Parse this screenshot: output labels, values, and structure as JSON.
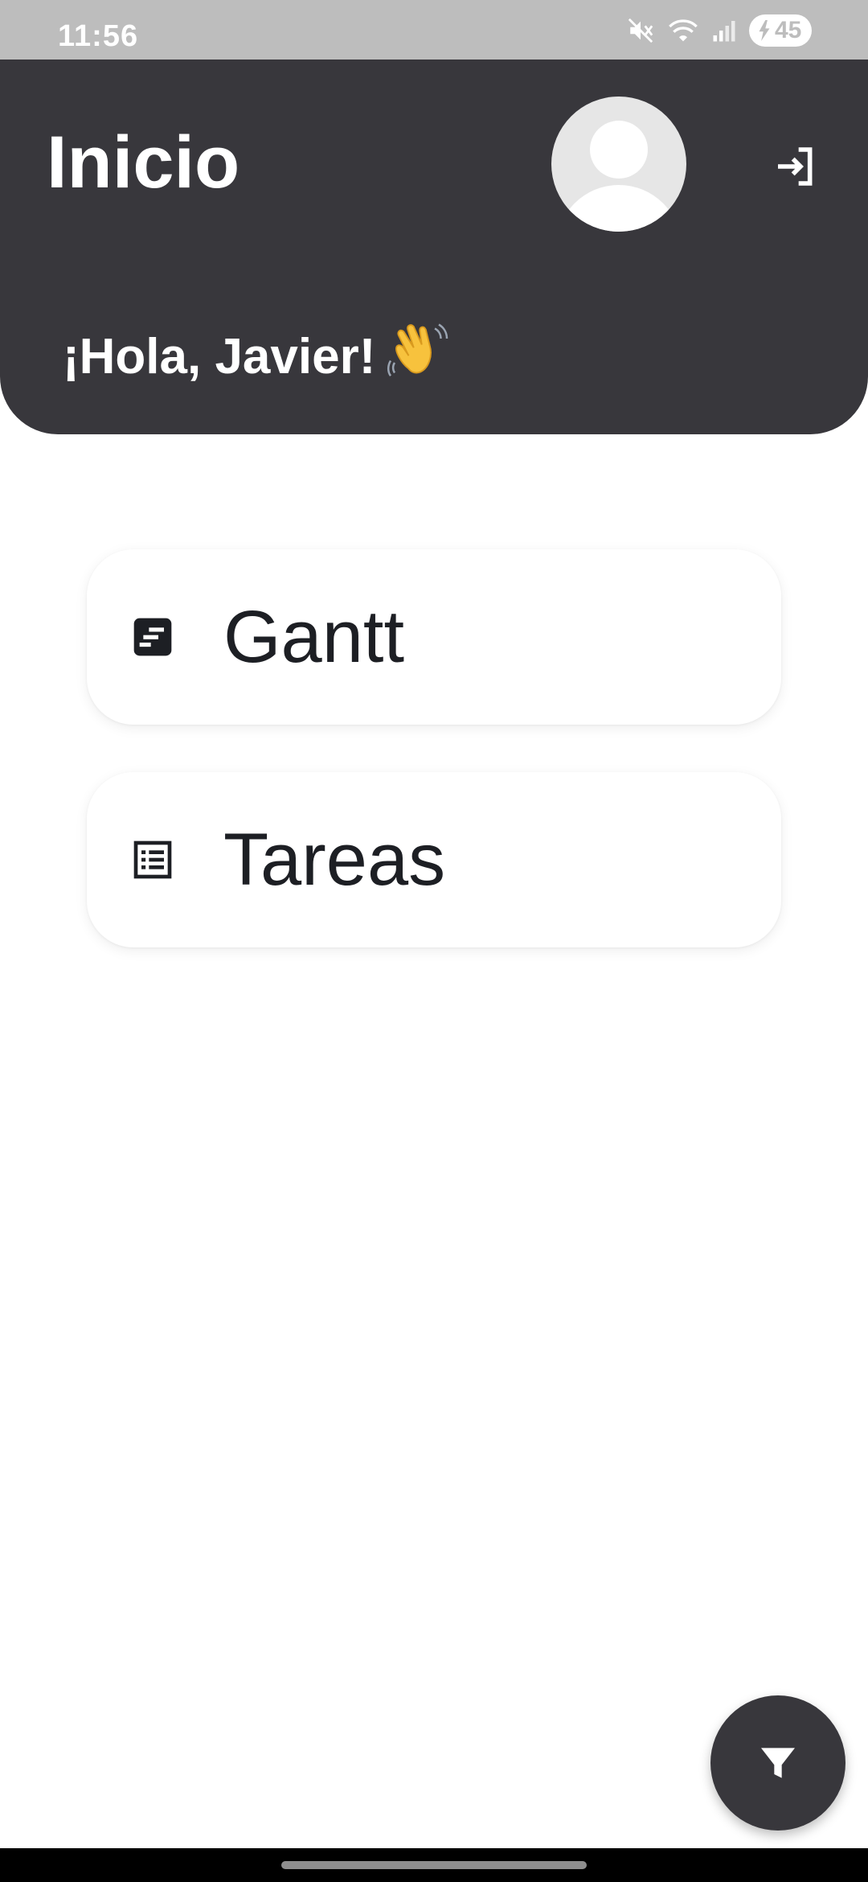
{
  "status_bar": {
    "time": "11:56",
    "battery_level": "45",
    "icons": [
      "mute-icon",
      "wifi-icon",
      "signal-icon",
      "battery-charging-icon"
    ]
  },
  "header": {
    "title": "Inicio",
    "greeting": "¡Hola, Javier!",
    "greeting_emoji": "waving-hand-icon",
    "logout_icon": "logout-icon",
    "avatar_icon": "user-avatar-icon"
  },
  "menu": {
    "items": [
      {
        "label": "Gantt",
        "icon": "gantt-chart-icon"
      },
      {
        "label": "Tareas",
        "icon": "task-list-icon"
      }
    ]
  },
  "fab": {
    "icon": "filter-icon"
  },
  "colors": {
    "header_bg": "#38373c",
    "status_bar_bg": "#bdbdbd",
    "card_bg": "#ffffff",
    "text_dark": "#1d1f24",
    "fab_bg": "#38373c"
  }
}
